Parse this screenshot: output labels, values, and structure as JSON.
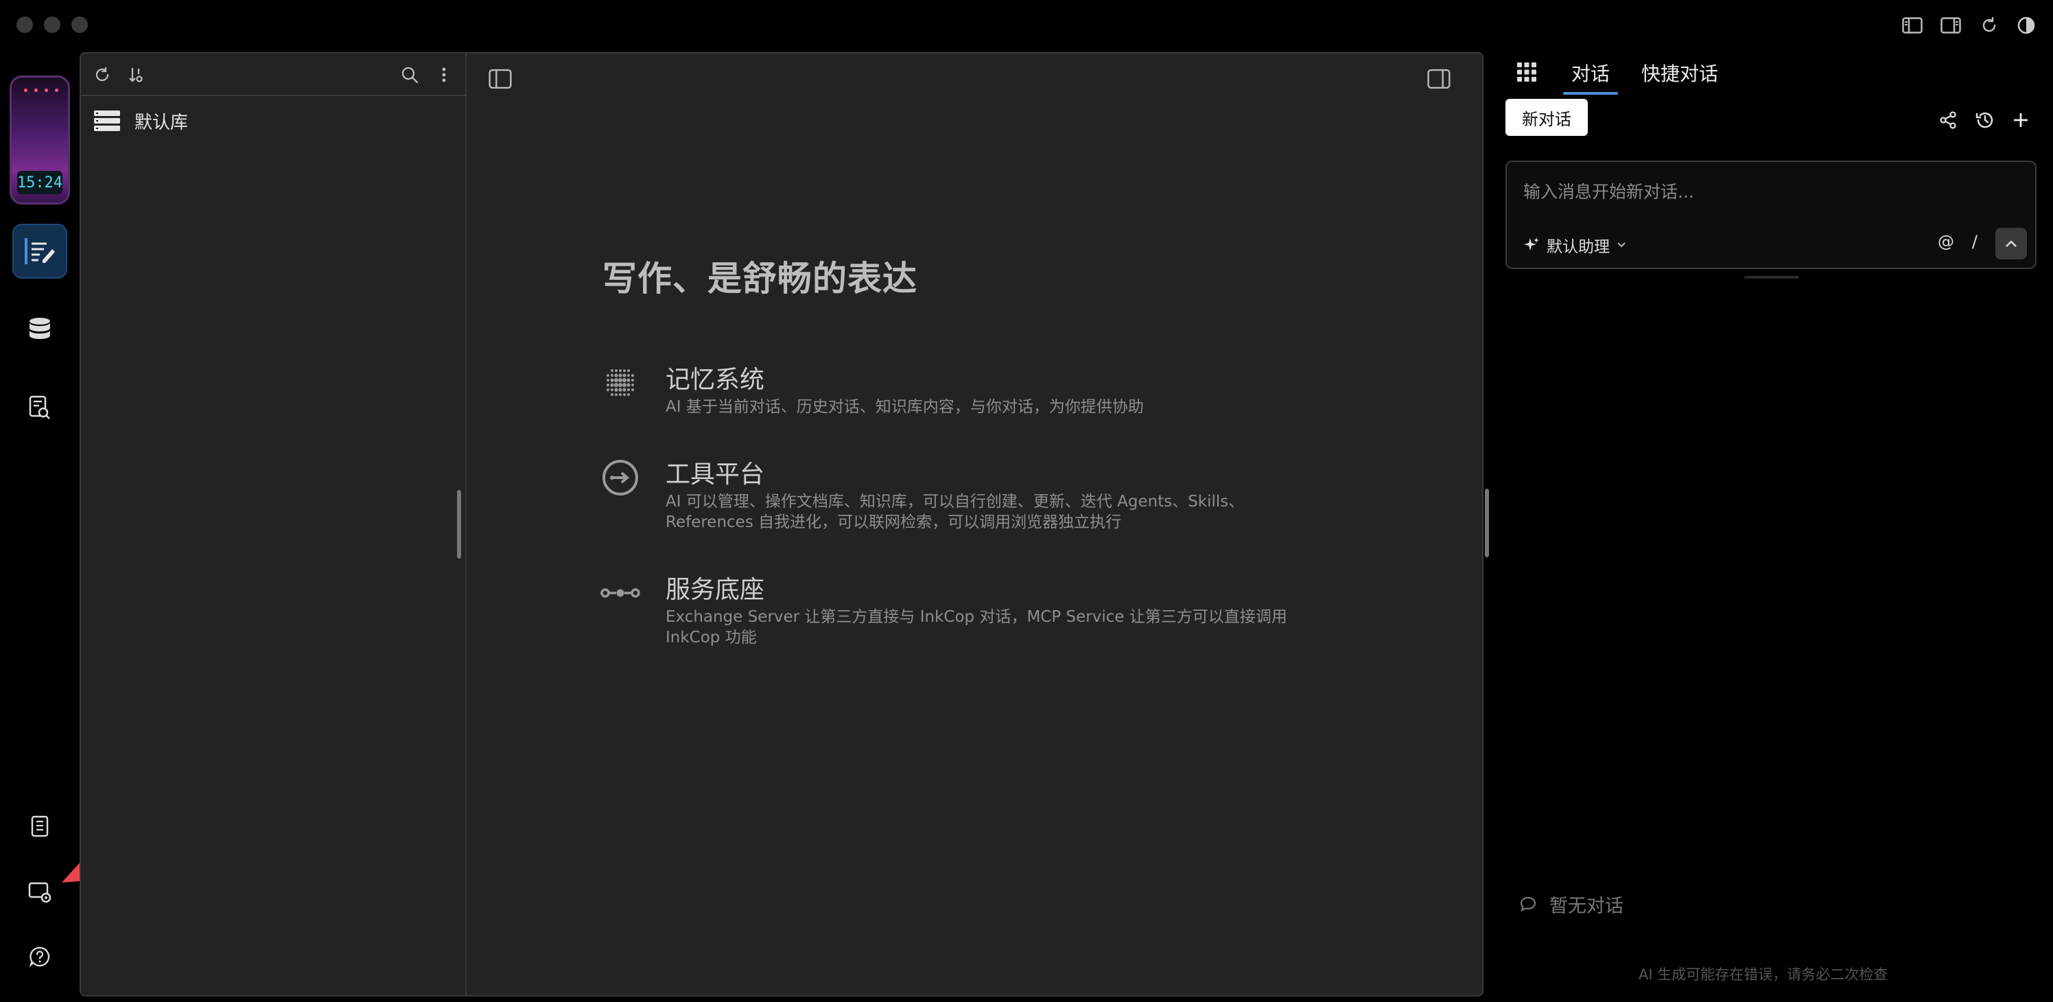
{
  "window": {
    "chrome_icons": [
      "sidebar-left-icon",
      "sidebar-right-icon",
      "refresh-icon",
      "contrast-icon"
    ]
  },
  "rail": {
    "widget_time": "15:24",
    "items": [
      {
        "icon": "write-icon",
        "active": true
      },
      {
        "icon": "database-icon",
        "active": false
      },
      {
        "icon": "document-search-icon",
        "active": false
      },
      {
        "icon": "notebook-icon",
        "active": false
      },
      {
        "icon": "screen-settings-icon",
        "active": false
      },
      {
        "icon": "help-icon",
        "active": false
      }
    ]
  },
  "sidebar": {
    "library_name": "默认库"
  },
  "editor": {
    "hero_title": "写作、是舒畅的表达",
    "features": [
      {
        "title": "记忆系统",
        "desc": "AI 基于当前对话、历史对话、知识库内容，与你对话，为你提供协助",
        "icon": "memory-dots-icon"
      },
      {
        "title": "工具平台",
        "desc": "AI 可以管理、操作文档库、知识库，可以自行创建、更新、迭代 Agents、Skills、References 自我进化，可以联网检索，可以调用浏览器独立执行",
        "icon": "tool-arrow-icon"
      },
      {
        "title": "服务底座",
        "desc": "Exchange Server 让第三方直接与 InkCop 对话，MCP Service 让第三方可以直接调用 InkCop 功能",
        "icon": "service-link-icon"
      }
    ]
  },
  "chat": {
    "tabs": [
      "对话",
      "快捷对话"
    ],
    "active_tab": 0,
    "new_chat_label": "新对话",
    "input_placeholder": "输入消息开始新对话...",
    "assistant_label": "默认助理",
    "at_symbol": "@",
    "slash_symbol": "/",
    "empty_text": "暂无对话",
    "disclaimer": "AI 生成可能存在错误，请务必二次检查"
  },
  "colors": {
    "accent": "#4a8fe0",
    "arrow": "#e8454d",
    "clock_text": "#4fd7e8"
  }
}
